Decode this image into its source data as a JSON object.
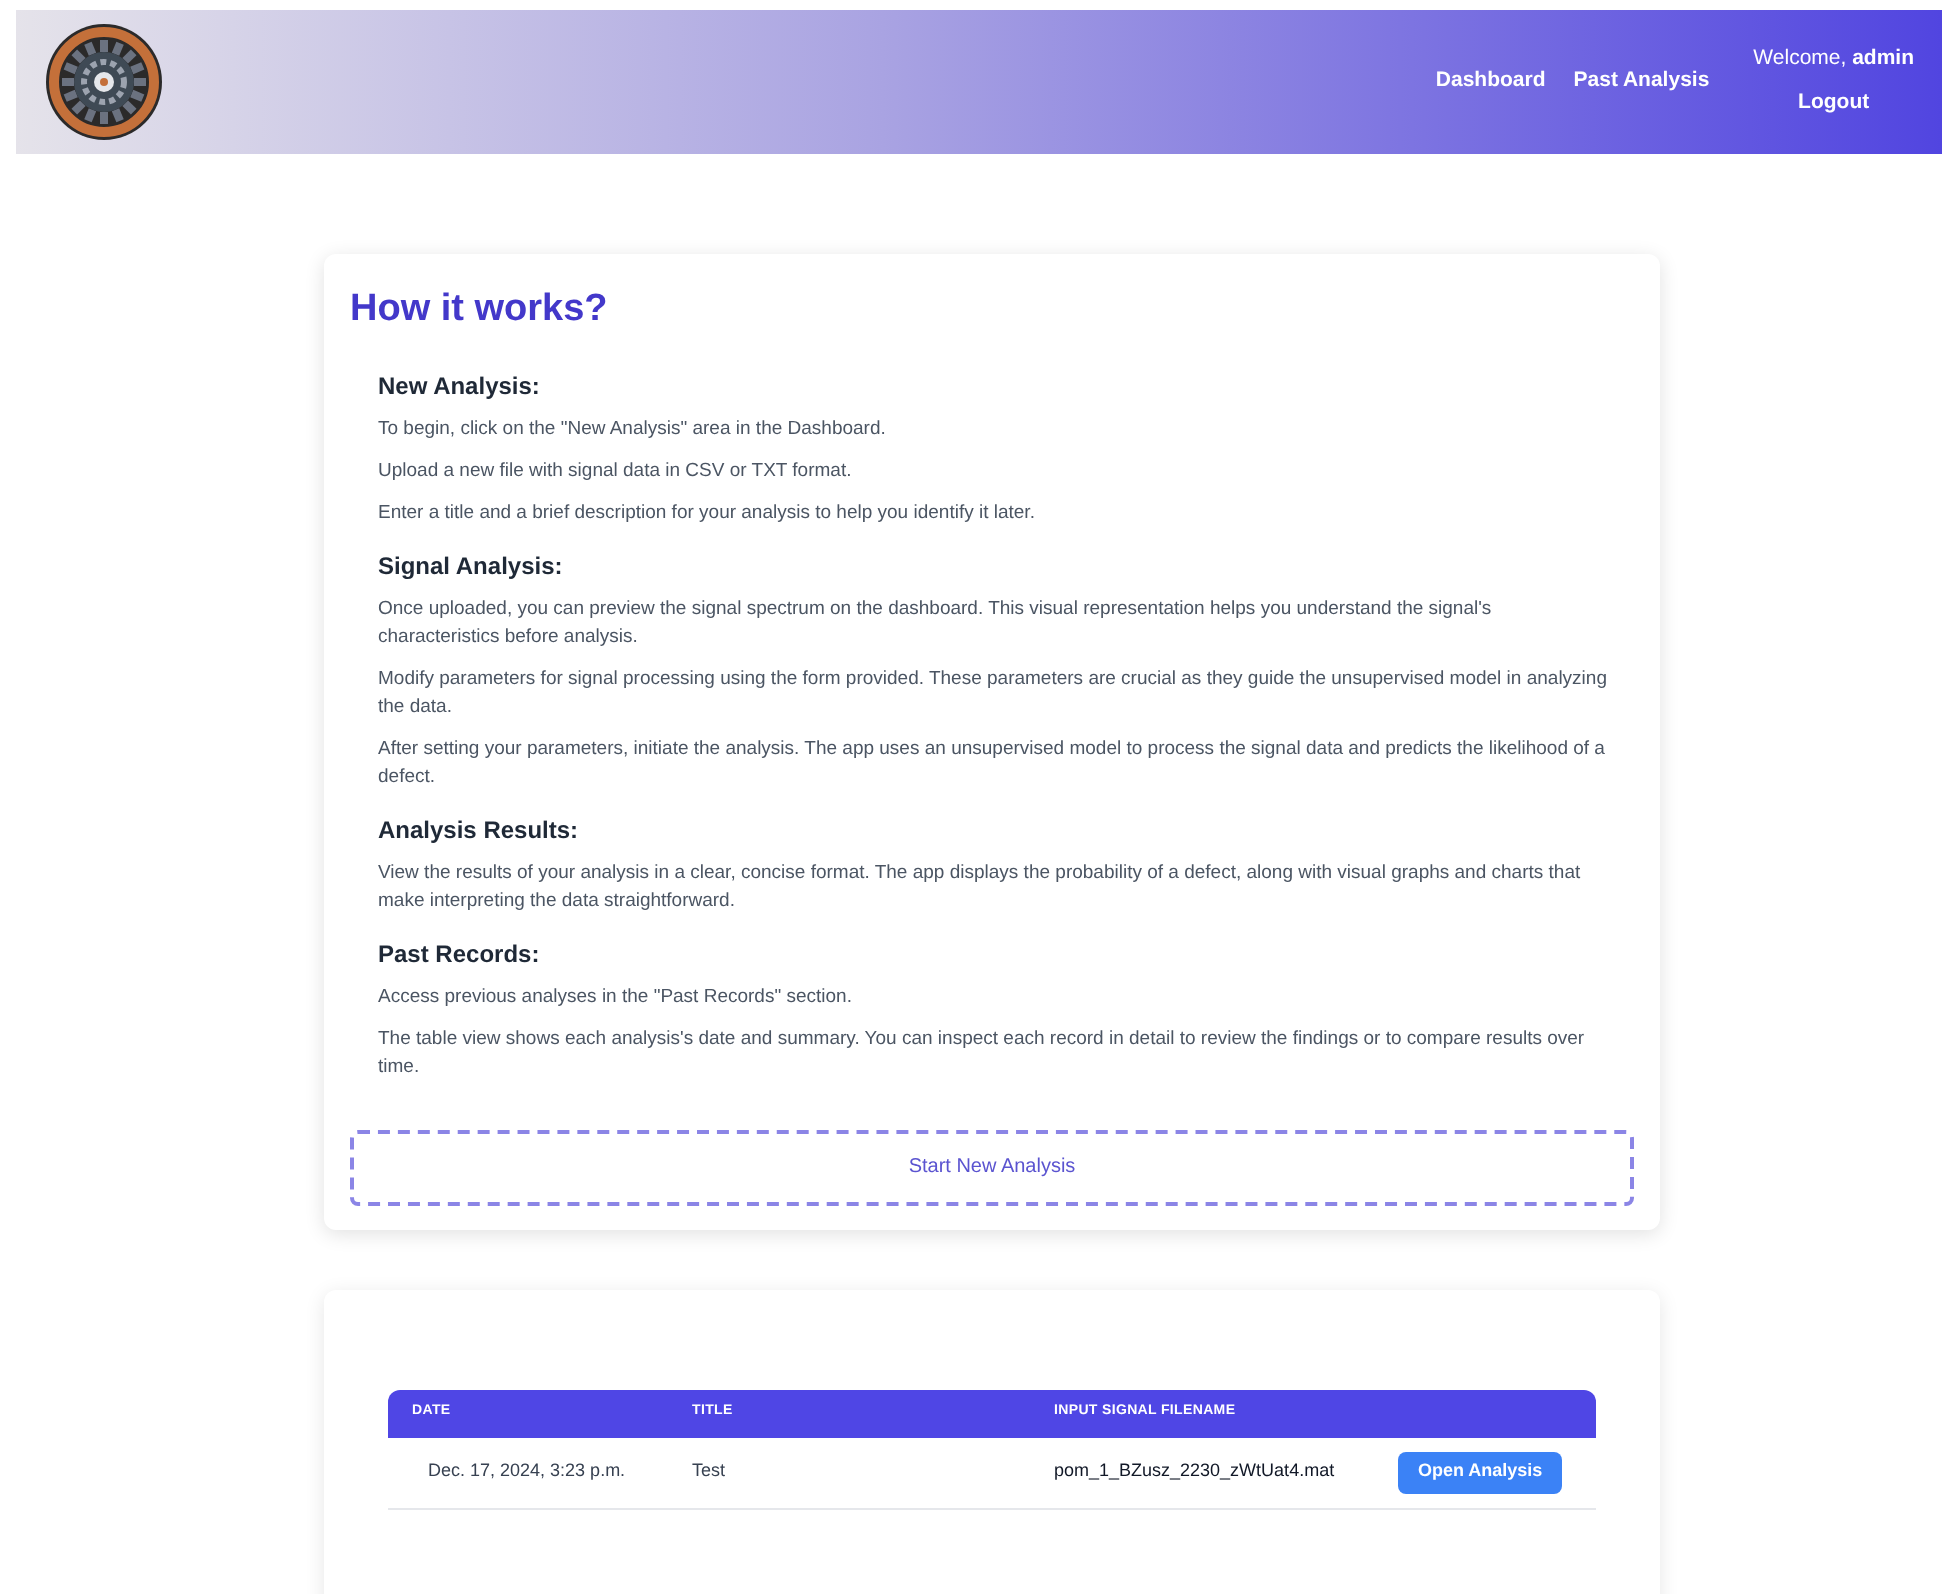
{
  "nav": {
    "links": [
      "Dashboard",
      "Past Analysis"
    ],
    "welcome": "Welcome, **admin**",
    "logout": "Logout"
  },
  "guide": {
    "title": "How it works?",
    "sections": [
      {
        "heading": "New Analysis:",
        "paragraphs": [
          "To begin, click on the \"New Analysis\" area in the Dashboard.",
          "Upload a new file with signal data in CSV or TXT format.",
          "Enter a title and a brief description for your analysis to help you identify it later."
        ]
      },
      {
        "heading": "Signal Analysis:",
        "paragraphs": [
          "Once uploaded, you can preview the signal spectrum on the dashboard. This visual representation helps you understand the signal's characteristics before analysis.",
          "Modify parameters for signal processing using the form provided. These parameters are crucial as they guide the unsupervised model in analyzing the data.",
          "After setting your parameters, initiate the analysis. The app uses an unsupervised model to process the signal data and predicts the likelihood of a defect."
        ]
      },
      {
        "heading": "Analysis Results:",
        "paragraphs": [
          "View the results of your analysis in a clear, concise format. The app displays the probability of a defect, along with visual graphs and charts that make interpreting the data straightforward."
        ]
      },
      {
        "heading": "Past Records:",
        "paragraphs": [
          "Access previous analyses in the \"Past Records\" section.",
          "The table view shows each analysis's date and summary. You can inspect each record in detail to review the findings or to compare results over time."
        ]
      }
    ],
    "start_button": "Start New Analysis"
  },
  "table": {
    "columns": [
      "DATE",
      "TITLE",
      "INPUT SIGNAL FILENAME"
    ],
    "rows": [
      {
        "date": "Dec. 17, 2024, 3:23 p.m.",
        "title": "Test",
        "filename": "pom_1_BZusz_2230_zWtUat4.mat",
        "action": "Open Analysis"
      }
    ]
  }
}
